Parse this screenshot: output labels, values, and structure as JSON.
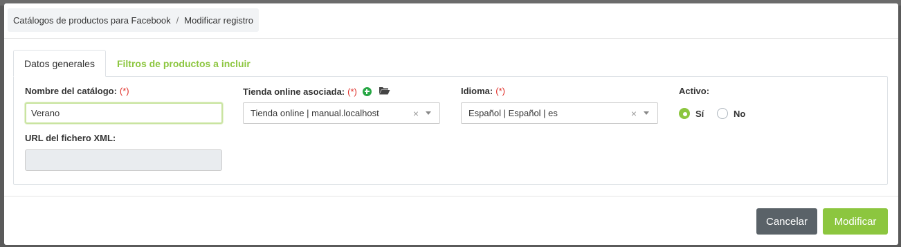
{
  "breadcrumb": {
    "parent": "Catálogos de productos para Facebook",
    "current": "Modificar registro"
  },
  "tabs": [
    {
      "label": "Datos generales",
      "active": true
    },
    {
      "label": "Filtros de productos a incluir",
      "active": false
    }
  ],
  "form": {
    "catalog_name": {
      "label": "Nombre del catálogo:",
      "required_mark": "(*)",
      "value": "Verano"
    },
    "xml_url": {
      "label": "URL del fichero XML:",
      "value": ""
    },
    "store": {
      "label": "Tienda online asociada:",
      "required_mark": "(*)",
      "value": "Tienda online | manual.localhost",
      "clear": "×"
    },
    "language": {
      "label": "Idioma:",
      "required_mark": "(*)",
      "value": "Español | Español | es",
      "clear": "×"
    },
    "active": {
      "label": "Activo:",
      "options": [
        "Sí",
        "No"
      ],
      "selected": "Sí"
    }
  },
  "footer": {
    "cancel_label": "Cancelar",
    "submit_label": "Modificar"
  },
  "colors": {
    "accent": "#8cc63f",
    "required": "#e0302a",
    "cancel": "#5a6268",
    "add_icon": "#28a745"
  }
}
